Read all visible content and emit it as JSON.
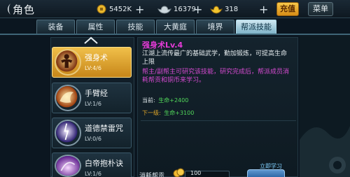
{
  "header": {
    "title": "角色",
    "resources": [
      {
        "icon": "coin-icon",
        "value": "5452K"
      },
      {
        "icon": "silver-ingot-icon",
        "value": "16379"
      },
      {
        "icon": "gold-ingot-icon",
        "value": "318"
      }
    ],
    "recharge_label": "充值",
    "menu_label": "菜单"
  },
  "tabs": [
    {
      "label": "装备",
      "active": false
    },
    {
      "label": "属性",
      "active": false
    },
    {
      "label": "技能",
      "active": false
    },
    {
      "label": "大黄庭",
      "active": false
    },
    {
      "label": "境界",
      "active": false
    },
    {
      "label": "帮派技能",
      "active": true
    }
  ],
  "skills": [
    {
      "name": "强身术",
      "level": "LV:4/6",
      "selected": true,
      "icon": "muscle-figure-icon"
    },
    {
      "name": "手臂经",
      "level": "LV:1/6",
      "selected": false,
      "icon": "flaming-fist-icon"
    },
    {
      "name": "道德禁雷咒",
      "level": "LV:0/6",
      "selected": false,
      "icon": "thunder-orb-icon"
    },
    {
      "name": "白帝抱朴诀",
      "level": "LV:1/6",
      "selected": false,
      "icon": "purple-vortex-icon"
    }
  ],
  "detail": {
    "title": "强身术Lv.4",
    "description": "江湖上流传最广的基础武学，勤加锻炼，可提高生命上限",
    "note": "帮主/副帮主可研究该技能，研究完成后，帮派成员消耗帮贡和铜币来学习。",
    "current_label": "当前:",
    "current_value": "生命+2400",
    "next_label": "下一级:",
    "next_value": "生命+3100",
    "cost_label": "消耗帮贡",
    "cost_value": "100",
    "learn_link": "立即学习"
  },
  "colors": {
    "tab_active": "#cfe7f1",
    "skill_selected": "#f1c04a",
    "skill_title": "#e33ad6",
    "stat_value": "#52d85a",
    "next_label": "#e0a728"
  }
}
